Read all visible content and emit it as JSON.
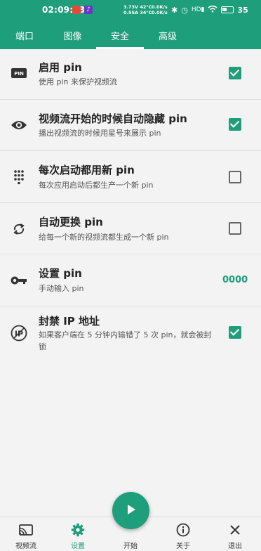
{
  "status_bar": {
    "time": "02:09:23",
    "stat_left": [
      "3.73V 42°C",
      "0.55A 34°C"
    ],
    "stat_right": [
      "0.0K/s",
      "0.0K/s"
    ],
    "network_label": "HD",
    "battery": "35"
  },
  "tabs": [
    {
      "label": "端口",
      "active": false
    },
    {
      "label": "图像",
      "active": false
    },
    {
      "label": "安全",
      "active": true
    },
    {
      "label": "高级",
      "active": false
    }
  ],
  "settings": [
    {
      "icon": "pin-badge-icon",
      "title": "启用 pin",
      "subtitle": "使用 pin 来保护视频流",
      "control": "checkbox",
      "checked": true
    },
    {
      "icon": "eye-icon",
      "title": "视频流开始的时候自动隐藏 pin",
      "subtitle": "播出视频流的时候用星号来展示 pin",
      "control": "checkbox",
      "checked": true
    },
    {
      "icon": "dialpad-icon",
      "title": "每次启动都用新 pin",
      "subtitle": "每次应用启动后都生产一个新 pin",
      "control": "checkbox",
      "checked": false
    },
    {
      "icon": "refresh-icon",
      "title": "自动更换 pin",
      "subtitle": "给每一个新的视频流都生成一个新 pin",
      "control": "checkbox",
      "checked": false
    },
    {
      "icon": "key-icon",
      "title": "设置 pin",
      "subtitle": "手动输入 pin",
      "control": "value",
      "value": "0000"
    },
    {
      "icon": "ip-block-icon",
      "title": "封禁 IP 地址",
      "subtitle": "如果客户端在 5 分钟内输错了 5 次 pin，就会被封锁",
      "control": "checkbox",
      "checked": true
    }
  ],
  "bottom_nav": [
    {
      "label": "视频流",
      "icon": "cast-icon",
      "active": false
    },
    {
      "label": "设置",
      "icon": "gear-icon",
      "active": true
    },
    {
      "label": "开始",
      "icon": "play-icon",
      "active": false
    },
    {
      "label": "关于",
      "icon": "info-icon",
      "active": false
    },
    {
      "label": "退出",
      "icon": "close-icon",
      "active": false
    }
  ],
  "colors": {
    "accent": "#1e9e7a",
    "background": "#f3f3f3",
    "text": "#222222"
  }
}
